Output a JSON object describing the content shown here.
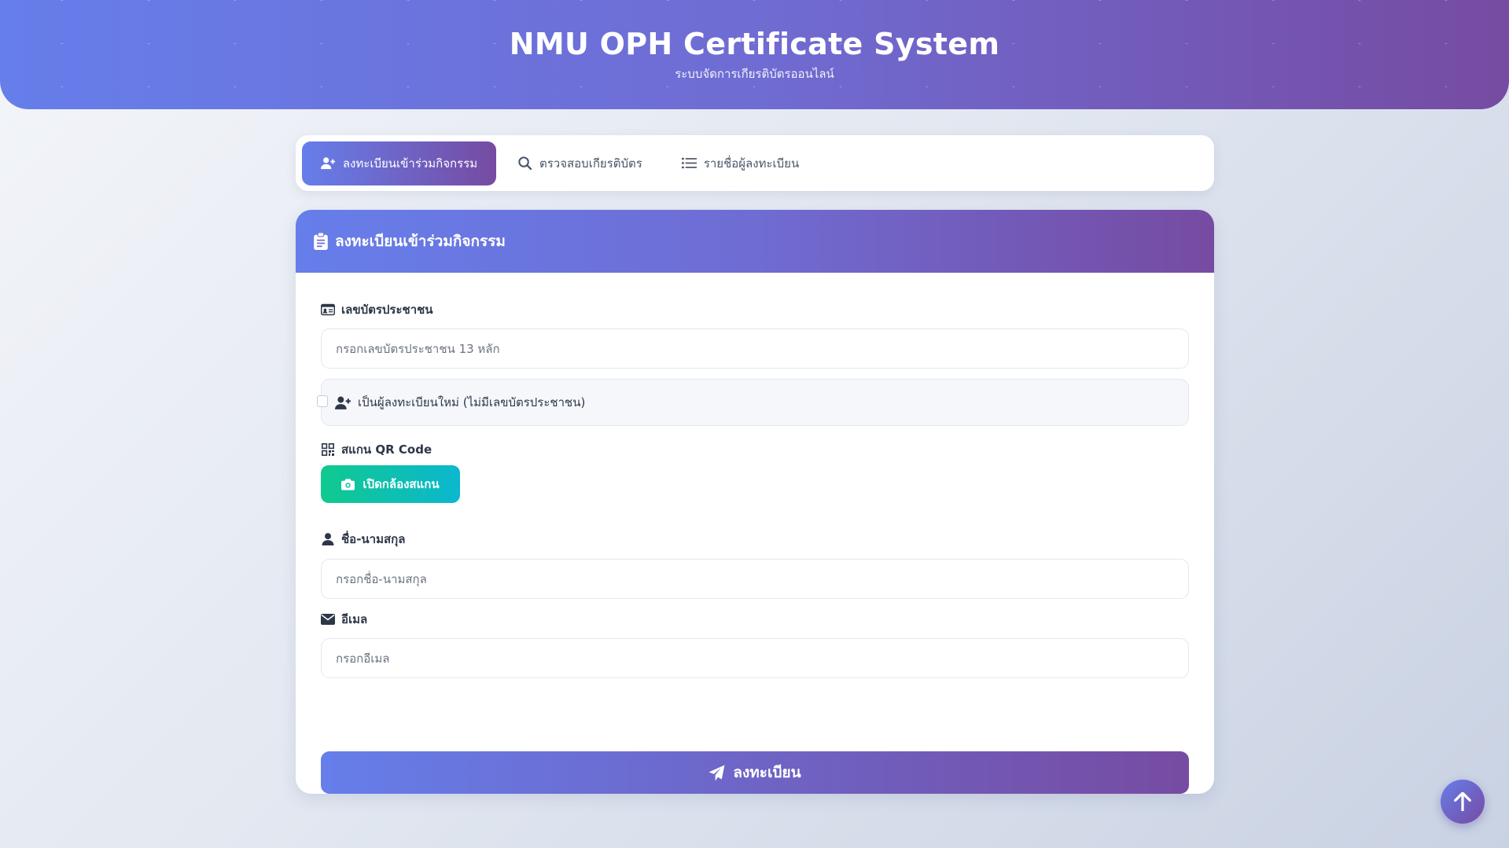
{
  "header": {
    "title": "NMU OPH Certificate System",
    "subtitle": "ระบบจัดการเกียรติบัตรออนไลน์"
  },
  "tabs": [
    {
      "label": "ลงทะเบียนเข้าร่วมกิจกรรม",
      "icon": "user-plus-icon",
      "active": true
    },
    {
      "label": "ตรวจสอบเกียรติบัตร",
      "icon": "search-icon",
      "active": false
    },
    {
      "label": "รายชื่อผู้ลงทะเบียน",
      "icon": "list-icon",
      "active": false
    }
  ],
  "form": {
    "card_title": "ลงทะเบียนเข้าร่วมกิจกรรม",
    "id_card_label": "เลขบัตรประชาชน",
    "id_card_placeholder": "กรอกเลขบัตรประชาชน 13 หลัก",
    "id_card_value": "",
    "new_registrant_label": "เป็นผู้ลงทะเบียนใหม่ (ไม่มีเลขบัตรประชาชน)",
    "new_registrant_checked": false,
    "qr_label": "สแกน QR Code",
    "scan_button": "เปิดกล้องสแกน",
    "name_label": "ชื่อ-นามสกุล",
    "name_placeholder": "กรอกชื่อ-นามสกุล",
    "name_value": "",
    "email_label": "อีเมล",
    "email_placeholder": "กรอกอีเมล",
    "email_value": "",
    "submit_button": "ลงทะเบียน"
  },
  "colors": {
    "gradient_start": "#667eea",
    "gradient_end": "#764ba2",
    "scan_gradient_start": "#10c98f",
    "scan_gradient_end": "#0bb7cf"
  }
}
